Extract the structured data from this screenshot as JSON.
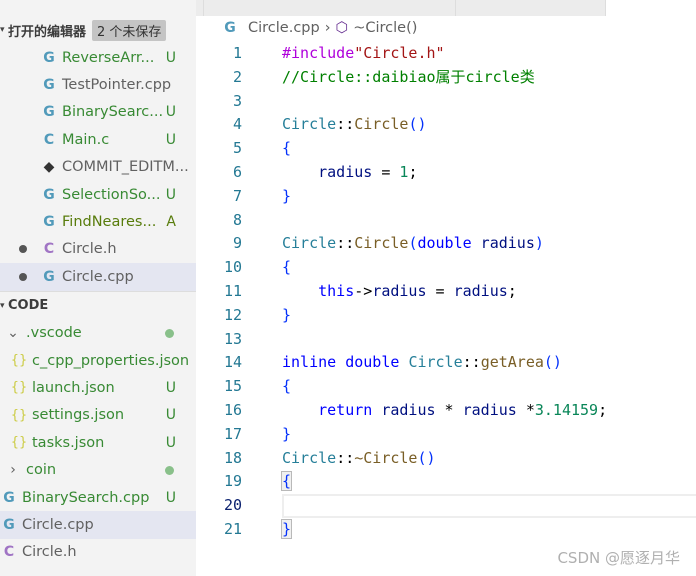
{
  "sidebar": {
    "open_editors": {
      "title": "打开的编辑器",
      "badge": "2 个未保存",
      "items": [
        {
          "icon": "cpp",
          "name": "ReverseArr...",
          "status": "U",
          "color": "g"
        },
        {
          "icon": "cpp",
          "name": "TestPointer.cpp",
          "status": "",
          "color": "n"
        },
        {
          "icon": "cpp",
          "name": "BinarySearc...",
          "status": "U",
          "color": "g"
        },
        {
          "icon": "c",
          "name": "Main.c",
          "status": "U",
          "color": "g"
        },
        {
          "icon": "git",
          "name": "COMMIT_EDITM...",
          "status": "",
          "color": "n"
        },
        {
          "icon": "cpp",
          "name": "SelectionSo...",
          "status": "U",
          "color": "g"
        },
        {
          "icon": "cpp",
          "name": "FindNeares...",
          "status": "A",
          "color": "a"
        },
        {
          "icon": "h",
          "name": "Circle.h",
          "status": "",
          "color": "n",
          "dirty": true
        },
        {
          "icon": "cpp",
          "name": "Circle.cpp",
          "status": "",
          "color": "n",
          "dirty": true,
          "selected": true
        }
      ]
    },
    "explorer": {
      "title": "CODE",
      "items": [
        {
          "type": "folder-open",
          "name": ".vscode",
          "indent": 1,
          "color": "g",
          "dot": true
        },
        {
          "icon": "json",
          "name": "c_cpp_properties.json",
          "indent": 2,
          "color": "g",
          "status": ""
        },
        {
          "icon": "json",
          "name": "launch.json",
          "indent": 2,
          "color": "g",
          "status": "U"
        },
        {
          "icon": "json",
          "name": "settings.json",
          "indent": 2,
          "color": "g",
          "status": "U"
        },
        {
          "icon": "json",
          "name": "tasks.json",
          "indent": 2,
          "color": "g",
          "status": "U"
        },
        {
          "type": "folder",
          "name": "coin",
          "indent": 1,
          "color": "g",
          "dot": true
        },
        {
          "icon": "cpp",
          "name": "BinarySearch.cpp",
          "indent": 0,
          "color": "g",
          "status": "U"
        },
        {
          "icon": "cpp",
          "name": "Circle.cpp",
          "indent": 0,
          "color": "n",
          "status": "",
          "selected": true
        },
        {
          "icon": "h",
          "name": "Circle.h",
          "indent": 0,
          "color": "n",
          "status": ""
        }
      ]
    }
  },
  "breadcrumb": {
    "file": "Circle.cpp",
    "symbol": "~Circle()"
  },
  "editor": {
    "current_line": 20,
    "lines": [
      [
        [
          "#include",
          "pp"
        ],
        [
          "\"Circle.h\"",
          "str"
        ]
      ],
      [
        [
          "//Circle::daibiao属于circle类",
          "cm"
        ]
      ],
      [],
      [
        [
          "Circle",
          "cls"
        ],
        [
          "::",
          "p"
        ],
        [
          "Circle",
          "fn"
        ],
        [
          "()",
          "br"
        ]
      ],
      [
        [
          "{",
          "br"
        ]
      ],
      [
        [
          "    ",
          "p"
        ],
        [
          "radius",
          "var"
        ],
        [
          " = ",
          "p"
        ],
        [
          "1",
          "num"
        ],
        [
          ";",
          "p"
        ]
      ],
      [
        [
          "}",
          "br"
        ]
      ],
      [],
      [
        [
          "Circle",
          "cls"
        ],
        [
          "::",
          "p"
        ],
        [
          "Circle",
          "fn"
        ],
        [
          "(",
          "br"
        ],
        [
          "double",
          "kw"
        ],
        [
          " radius",
          "var"
        ],
        [
          ")",
          "br"
        ]
      ],
      [
        [
          "{",
          "br"
        ]
      ],
      [
        [
          "    ",
          "p"
        ],
        [
          "this",
          "kw"
        ],
        [
          "->",
          "p"
        ],
        [
          "radius",
          "var"
        ],
        [
          " = ",
          "p"
        ],
        [
          "radius",
          "var"
        ],
        [
          ";",
          "p"
        ]
      ],
      [
        [
          "}",
          "br"
        ]
      ],
      [],
      [
        [
          "inline",
          "kw"
        ],
        [
          " double ",
          "kw"
        ],
        [
          "Circle",
          "cls"
        ],
        [
          "::",
          "p"
        ],
        [
          "getArea",
          "fn"
        ],
        [
          "()",
          "br"
        ]
      ],
      [
        [
          "{",
          "br"
        ]
      ],
      [
        [
          "    ",
          "p"
        ],
        [
          "return",
          "kw"
        ],
        [
          " radius",
          "var"
        ],
        [
          " * ",
          "p"
        ],
        [
          "radius",
          "var"
        ],
        [
          " *",
          "p"
        ],
        [
          "3.14159",
          "num"
        ],
        [
          ";",
          "p"
        ]
      ],
      [
        [
          "}",
          "br"
        ]
      ],
      [
        [
          "Circle",
          "cls"
        ],
        [
          "::",
          "p"
        ],
        [
          "~Circle",
          "fn"
        ],
        [
          "()",
          "br"
        ]
      ],
      [
        [
          "{",
          "brm"
        ]
      ],
      [],
      [
        [
          "}",
          "brm"
        ]
      ]
    ]
  },
  "watermark": "CSDN @愿逐月华"
}
